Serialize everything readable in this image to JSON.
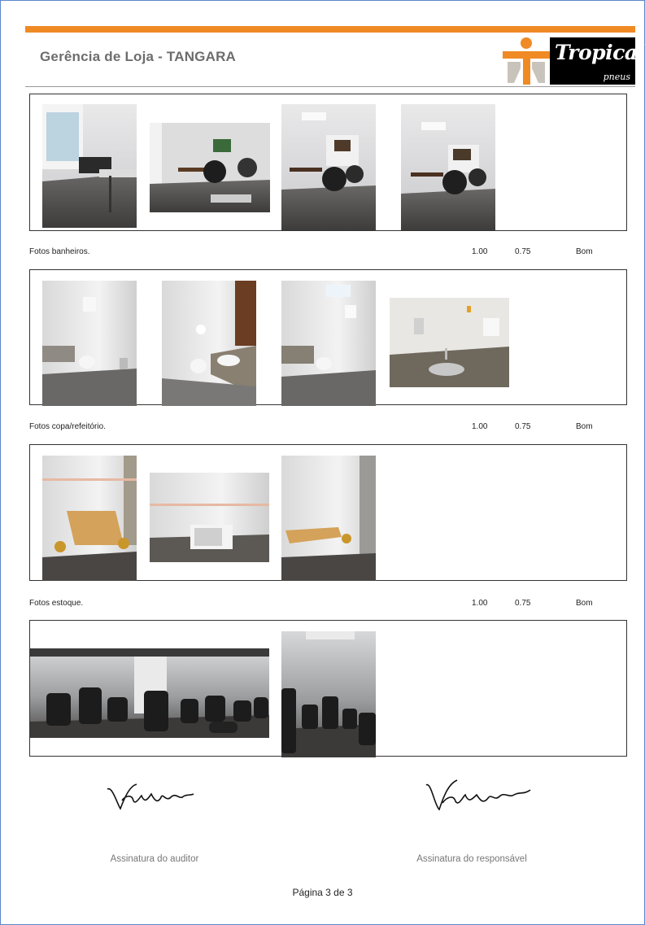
{
  "header": {
    "title": "Gerência de Loja - TANGARA",
    "logo_word": "Tropical",
    "logo_sub": "pneus",
    "accent_color": "#f08a24"
  },
  "sections": [
    {
      "label": "Fotos banheiros.",
      "val1": "1.00",
      "val2": "0.75",
      "status": "Bom"
    },
    {
      "label": "Fotos copa/refeitório.",
      "val1": "1.00",
      "val2": "0.75",
      "status": "Bom"
    },
    {
      "label": "Fotos estoque.",
      "val1": "1.00",
      "val2": "0.75",
      "status": "Bom"
    }
  ],
  "signatures": {
    "auditor_caption": "Assinatura do auditor",
    "responsavel_caption": "Assinatura do responsável"
  },
  "footer": {
    "page": "Página 3 de 3"
  }
}
